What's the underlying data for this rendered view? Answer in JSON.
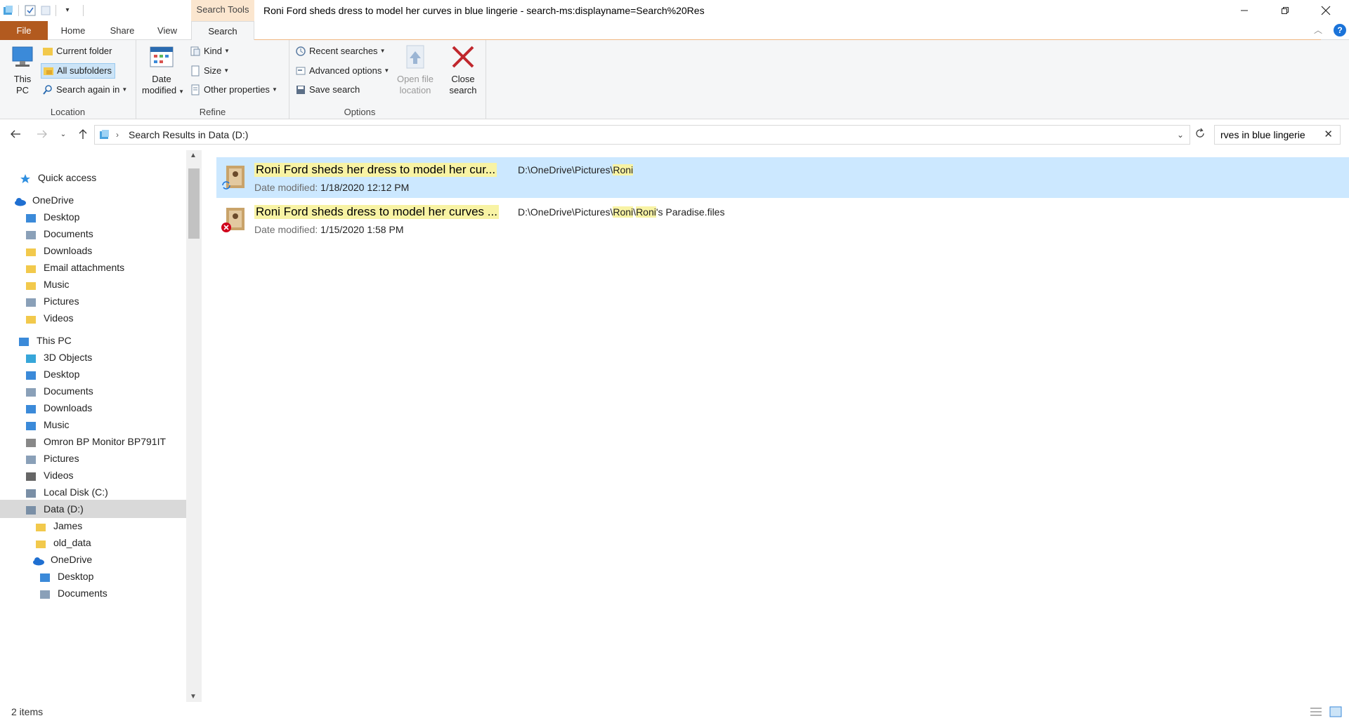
{
  "window": {
    "title": "Roni Ford sheds dress to model her curves in blue lingerie - search-ms:displayname=Search%20Res",
    "context_tab": "Search Tools"
  },
  "tabs": {
    "file": "File",
    "home": "Home",
    "share": "Share",
    "view": "View",
    "search": "Search"
  },
  "ribbon": {
    "location": {
      "label": "Location",
      "this_pc_line1": "This",
      "this_pc_line2": "PC",
      "current_folder": "Current folder",
      "all_subfolders": "All subfolders",
      "search_again_in": "Search again in"
    },
    "refine": {
      "label": "Refine",
      "date_modified_line1": "Date",
      "date_modified_line2": "modified",
      "kind": "Kind",
      "size": "Size",
      "other_properties": "Other properties"
    },
    "options": {
      "label": "Options",
      "recent_searches": "Recent searches",
      "advanced_options": "Advanced options",
      "save_search": "Save search",
      "open_file_location_line1": "Open file",
      "open_file_location_line2": "location",
      "close_search_line1": "Close",
      "close_search_line2": "search"
    }
  },
  "address": {
    "path": "Search Results in Data (D:)",
    "search_value": "rves in blue lingerie"
  },
  "nav": {
    "items": [
      {
        "label": "Quick access",
        "icon": "star-icon"
      },
      {
        "label": "OneDrive",
        "icon": "cloud-icon"
      },
      {
        "label": "Desktop",
        "icon": "desktop-icon"
      },
      {
        "label": "Documents",
        "icon": "documents-icon"
      },
      {
        "label": "Downloads",
        "icon": "folder-icon"
      },
      {
        "label": "Email attachments",
        "icon": "folder-icon"
      },
      {
        "label": "Music",
        "icon": "folder-icon"
      },
      {
        "label": "Pictures",
        "icon": "pictures-icon"
      },
      {
        "label": "Videos",
        "icon": "folder-icon"
      },
      {
        "label": "This PC",
        "icon": "computer-icon"
      },
      {
        "label": "3D Objects",
        "icon": "cube-icon"
      },
      {
        "label": "Desktop",
        "icon": "desktop-icon"
      },
      {
        "label": "Documents",
        "icon": "documents-icon"
      },
      {
        "label": "Downloads",
        "icon": "download-icon"
      },
      {
        "label": "Music",
        "icon": "music-icon"
      },
      {
        "label": "Omron BP Monitor BP791IT",
        "icon": "device-icon"
      },
      {
        "label": "Pictures",
        "icon": "pictures-icon"
      },
      {
        "label": "Videos",
        "icon": "video-icon"
      },
      {
        "label": "Local Disk (C:)",
        "icon": "drive-icon"
      },
      {
        "label": "Data (D:)",
        "icon": "drive-icon"
      },
      {
        "label": "James",
        "icon": "folder-icon"
      },
      {
        "label": "old_data",
        "icon": "folder-icon"
      },
      {
        "label": "OneDrive",
        "icon": "cloud-icon"
      },
      {
        "label": "Desktop",
        "icon": "desktop-icon"
      },
      {
        "label": "Documents",
        "icon": "documents-icon"
      }
    ]
  },
  "results": [
    {
      "name": "Roni Ford sheds her dress to model her cur...",
      "date_label": "Date modified:",
      "date": "1/18/2020 12:12 PM",
      "path_prefix": "D:\\OneDrive\\Pictures\\",
      "path_hl1": "Roni",
      "path_mid": "",
      "path_hl2": "",
      "path_suffix": ""
    },
    {
      "name": "Roni Ford sheds dress to model her curves ...",
      "date_label": "Date modified:",
      "date": "1/15/2020 1:58 PM",
      "path_prefix": "D:\\OneDrive\\Pictures\\",
      "path_hl1": "Roni",
      "path_mid": "\\",
      "path_hl2": "Roni",
      "path_suffix": "'s Paradise.files"
    }
  ],
  "status": {
    "items": "2 items"
  },
  "colors": {
    "file_tab": "#b25a1f",
    "selection": "#cce8ff",
    "highlight": "#f8f3a4",
    "context_tab": "#fbe6cf"
  }
}
